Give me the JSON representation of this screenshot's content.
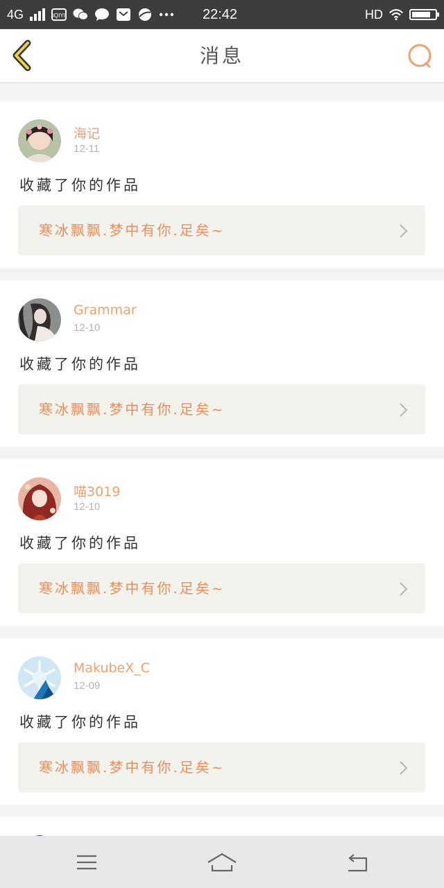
{
  "status_bar": {
    "network": "4G",
    "time": "22:42",
    "hd": "HD",
    "icons": [
      "signal-icon",
      "iqiyi-icon",
      "wechat-icon",
      "message-icon",
      "mail-icon",
      "browser-icon",
      "more-icon",
      "wifi-icon",
      "battery-icon"
    ]
  },
  "header": {
    "title": "消息",
    "back_icon": "chevron-left-icon",
    "search_icon": "search-icon"
  },
  "colors": {
    "accent": "#eea16c",
    "work_title": "#eb8d5a",
    "card_bg": "#ffffff",
    "work_bg": "#f3f3ee",
    "page_bg": "#f4f4f4"
  },
  "messages": [
    {
      "username": "海记",
      "date": "12-11",
      "action": "收藏了你的作品",
      "work_title": "寒冰飘飘.梦中有你.足矣~"
    },
    {
      "username": "Grammar",
      "date": "12-10",
      "action": "收藏了你的作品",
      "work_title": "寒冰飘飘.梦中有你.足矣~"
    },
    {
      "username": "喵3019",
      "date": "12-10",
      "action": "收藏了你的作品",
      "work_title": "寒冰飘飘.梦中有你.足矣~"
    },
    {
      "username": "MakubeX_C",
      "date": "12-09",
      "action": "收藏了你的作品",
      "work_title": "寒冰飘飘.梦中有你.足矣~"
    }
  ],
  "nav_bar": {
    "icons": [
      "menu-icon",
      "home-icon",
      "back-icon"
    ]
  }
}
